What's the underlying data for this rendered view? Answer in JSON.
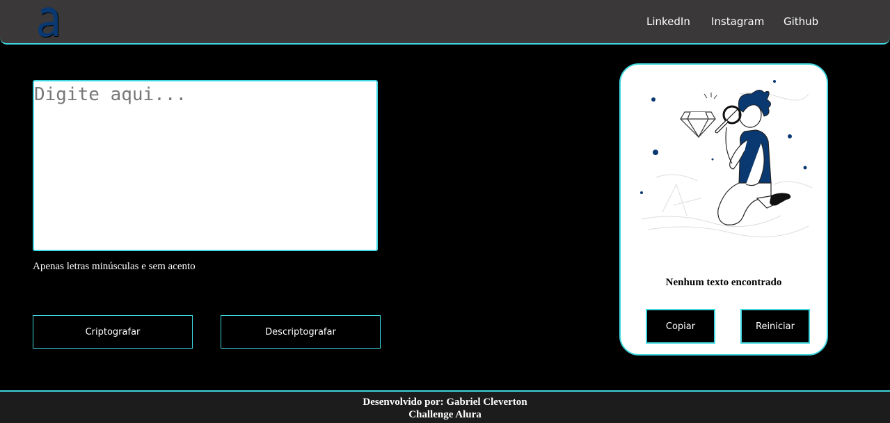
{
  "header": {
    "logo_icon": "alura-a-logo-icon",
    "nav": [
      "LinkedIn",
      "Instagram",
      "Github"
    ]
  },
  "editor": {
    "placeholder": "Digite aqui...",
    "hint": "Apenas letras minúsculas e sem acento",
    "encrypt_label": "Criptografar",
    "decrypt_label": "Descriptografar"
  },
  "output": {
    "illustration_icon": "person-with-magnifier-illustration",
    "empty_message": "Nenhum texto encontrado",
    "copy_label": "Copiar",
    "reset_label": "Reiniciar"
  },
  "footer": {
    "line1": "Desenvolvido por: Gabriel Cleverton",
    "line2": "Challenge Alura"
  },
  "colors": {
    "accent": "#3fd7e0",
    "header_bg": "#3a3839",
    "logo_blue": "#0a3871"
  }
}
